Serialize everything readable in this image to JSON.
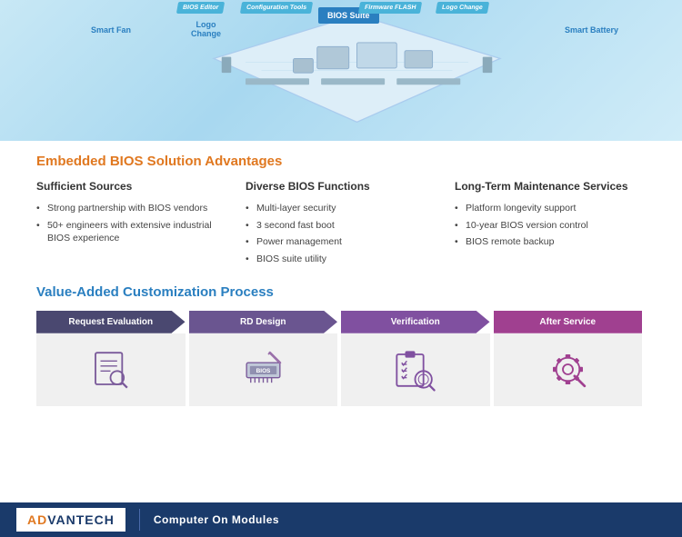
{
  "diagram": {
    "labels": {
      "smart_fan": "Smart Fan",
      "logo_change": "Logo\nChange",
      "bios_suite": "BIOS Suite",
      "config_tools": "Configuration Tools",
      "firmware_flash": "Firmware FLASH",
      "logo_change_top": "Logo Change",
      "bios_editor": "BIOS Editor",
      "smart_battery": "Smart Battery"
    }
  },
  "embedded_section": {
    "title": "Embedded BIOS Solution Advantages",
    "columns": [
      {
        "heading": "Sufficient Sources",
        "items": [
          "Strong partnership with BIOS vendors",
          "50+ engineers with extensive industrial BIOS experience"
        ]
      },
      {
        "heading": "Diverse BIOS Functions",
        "items": [
          "Multi-layer security",
          "3 second fast boot",
          "Power management",
          "BIOS suite utility"
        ]
      },
      {
        "heading": "Long-Term Maintenance Services",
        "items": [
          "Platform longevity support",
          "10-year BIOS version control",
          "BIOS remote backup"
        ]
      }
    ]
  },
  "value_section": {
    "title": "Value-Added Customization Process",
    "steps": [
      {
        "label": "Request Evaluation",
        "color": "#4a4870"
      },
      {
        "label": "RD Design",
        "color": "#6a5590"
      },
      {
        "label": "Verification",
        "color": "#8050a0"
      },
      {
        "label": "After Service",
        "color": "#a04090"
      }
    ]
  },
  "footer": {
    "brand": "AD⧺NTECH",
    "brand_ad": "AD",
    "brand_rest": "VANTECH",
    "subtitle": "Computer On Modules"
  }
}
